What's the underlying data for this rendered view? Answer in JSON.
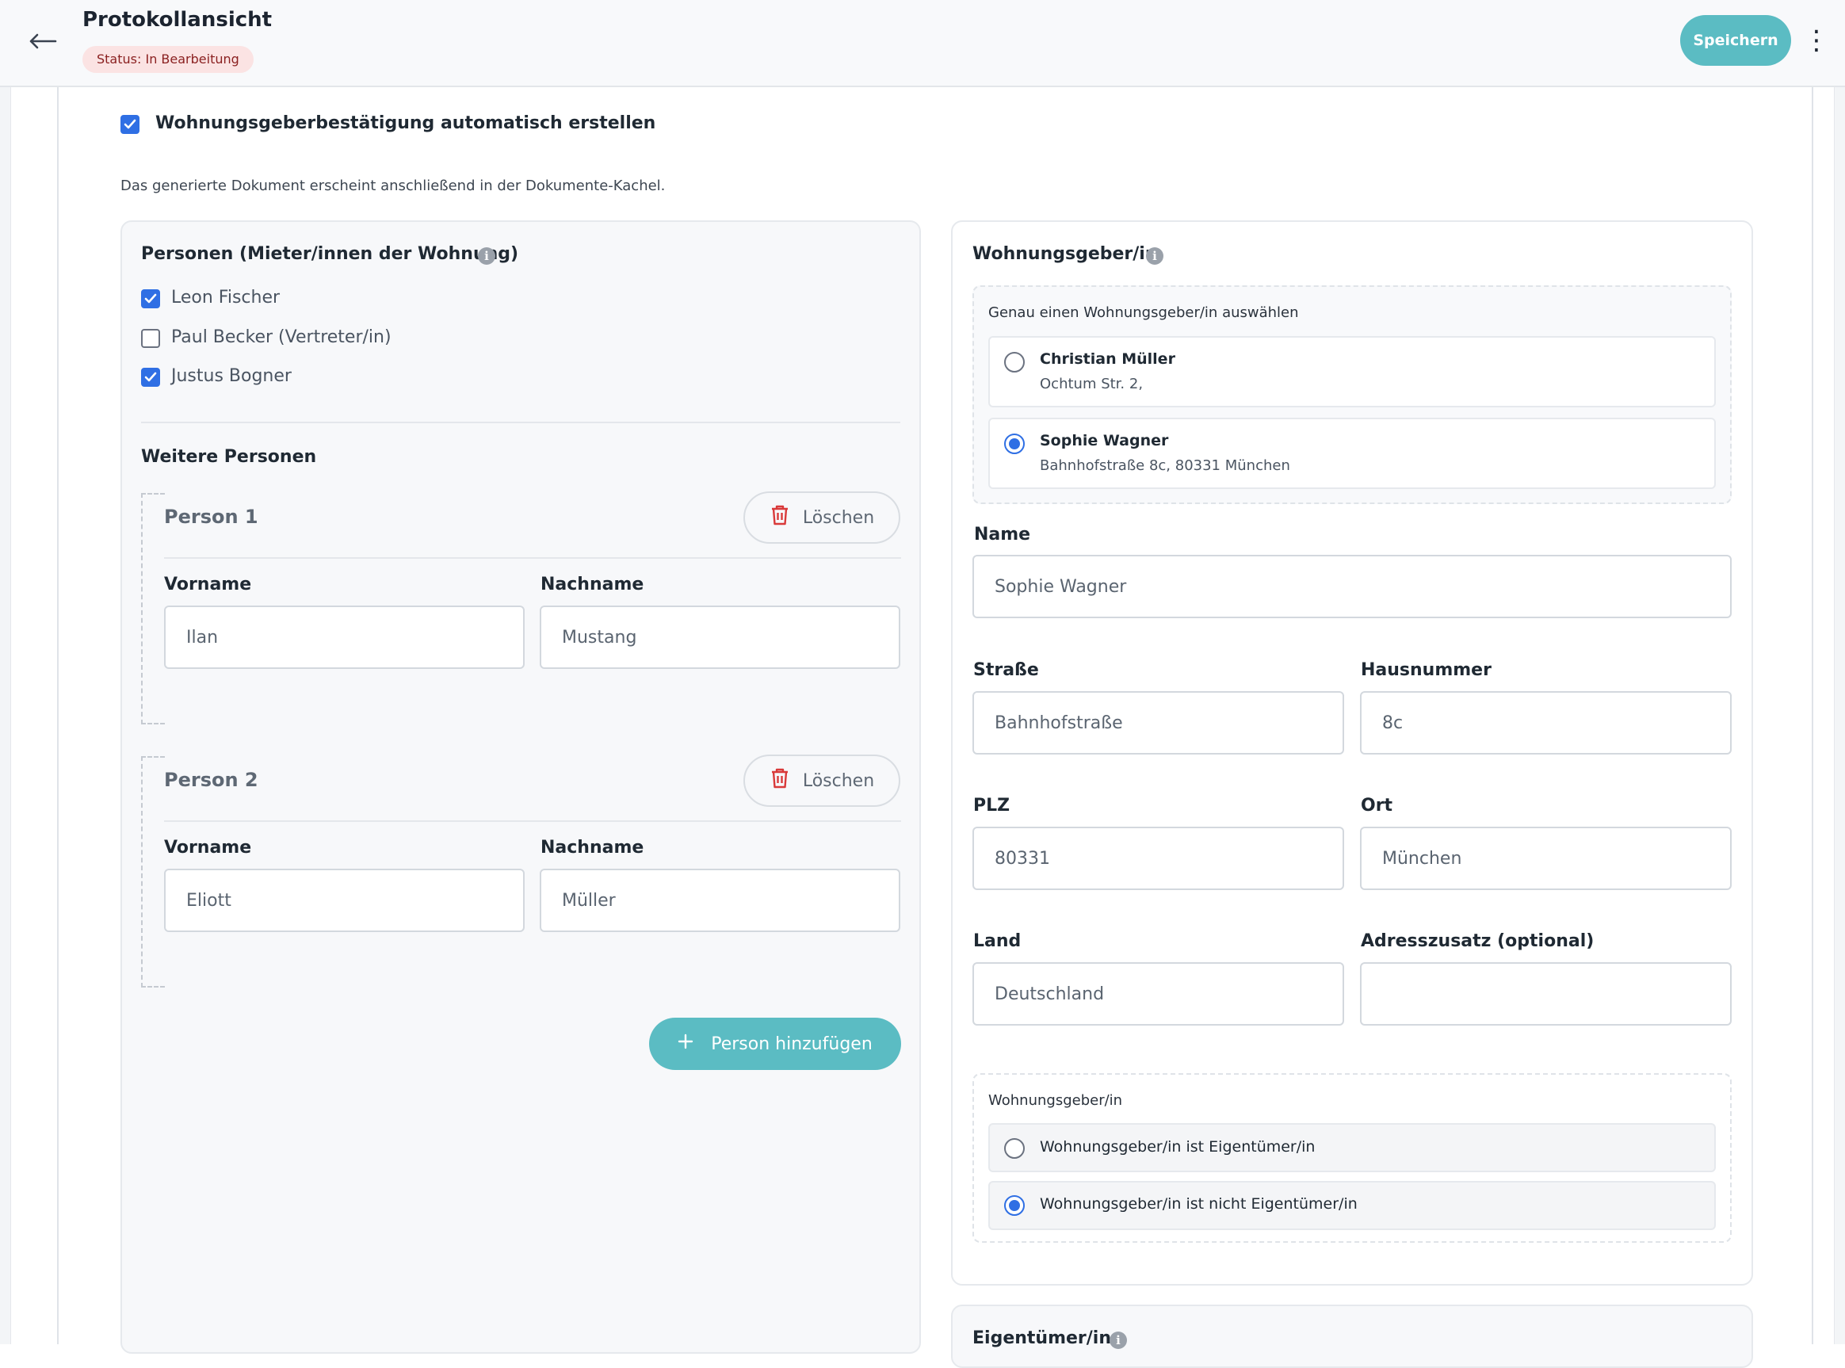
{
  "header": {
    "title": "Protokollansicht",
    "status_prefix": "Status:",
    "status_value": "In Bearbeitung",
    "save_label": "Speichern",
    "more_icon": "⋮"
  },
  "auto_confirm": {
    "label": "Wohnungsgeberbestätigung automatisch erstellen",
    "checked": true,
    "hint": "Das generierte Dokument erscheint anschließend in der Dokumente-Kachel."
  },
  "persons": {
    "title": "Personen (Mieter/innen der Wohnung)",
    "list": [
      {
        "name": "Leon Fischer",
        "checked": true
      },
      {
        "name": "Paul Becker (Vertreter/in)",
        "checked": false
      },
      {
        "name": "Justus Bogner",
        "checked": true
      }
    ],
    "further_title": "Weitere Personen",
    "further": [
      {
        "title": "Person 1",
        "delete_label": "Löschen",
        "first_label": "Vorname",
        "first_value": "Ilan",
        "last_label": "Nachname",
        "last_value": "Mustang"
      },
      {
        "title": "Person 2",
        "delete_label": "Löschen",
        "first_label": "Vorname",
        "first_value": "Eliott",
        "last_label": "Nachname",
        "last_value": "Müller"
      }
    ],
    "add_label": "Person hinzufügen"
  },
  "landlord": {
    "title": "Wohnungsgeber/in",
    "select_hint": "Genau einen Wohnungsgeber/in auswählen",
    "options": [
      {
        "name": "Christian Müller",
        "address": "Ochtum Str. 2,",
        "selected": false
      },
      {
        "name": "Sophie Wagner",
        "address": "Bahnhofstraße 8c, 80331 München",
        "selected": true
      }
    ],
    "fields": {
      "name_label": "Name",
      "name_value": "Sophie Wagner",
      "street_label": "Straße",
      "street_value": "Bahnhofstraße",
      "house_label": "Hausnummer",
      "house_value": "8c",
      "zip_label": "PLZ",
      "zip_value": "80331",
      "city_label": "Ort",
      "city_value": "München",
      "country_label": "Land",
      "country_value": "Deutschland",
      "extra_label": "Adresszusatz (optional)",
      "extra_value": ""
    },
    "owner_box_title": "Wohnungsgeber/in",
    "owner_options": [
      {
        "label": "Wohnungsgeber/in ist Eigentümer/in",
        "selected": false
      },
      {
        "label": "Wohnungsgeber/in ist nicht Eigentümer/in",
        "selected": true
      }
    ]
  },
  "owner_section": {
    "title": "Eigentümer/in"
  },
  "colors": {
    "accent": "#5bbcc3",
    "checkbox": "#2f6fe4",
    "status_bg": "#fbe3e3",
    "delete_icon": "#d93a3a"
  }
}
